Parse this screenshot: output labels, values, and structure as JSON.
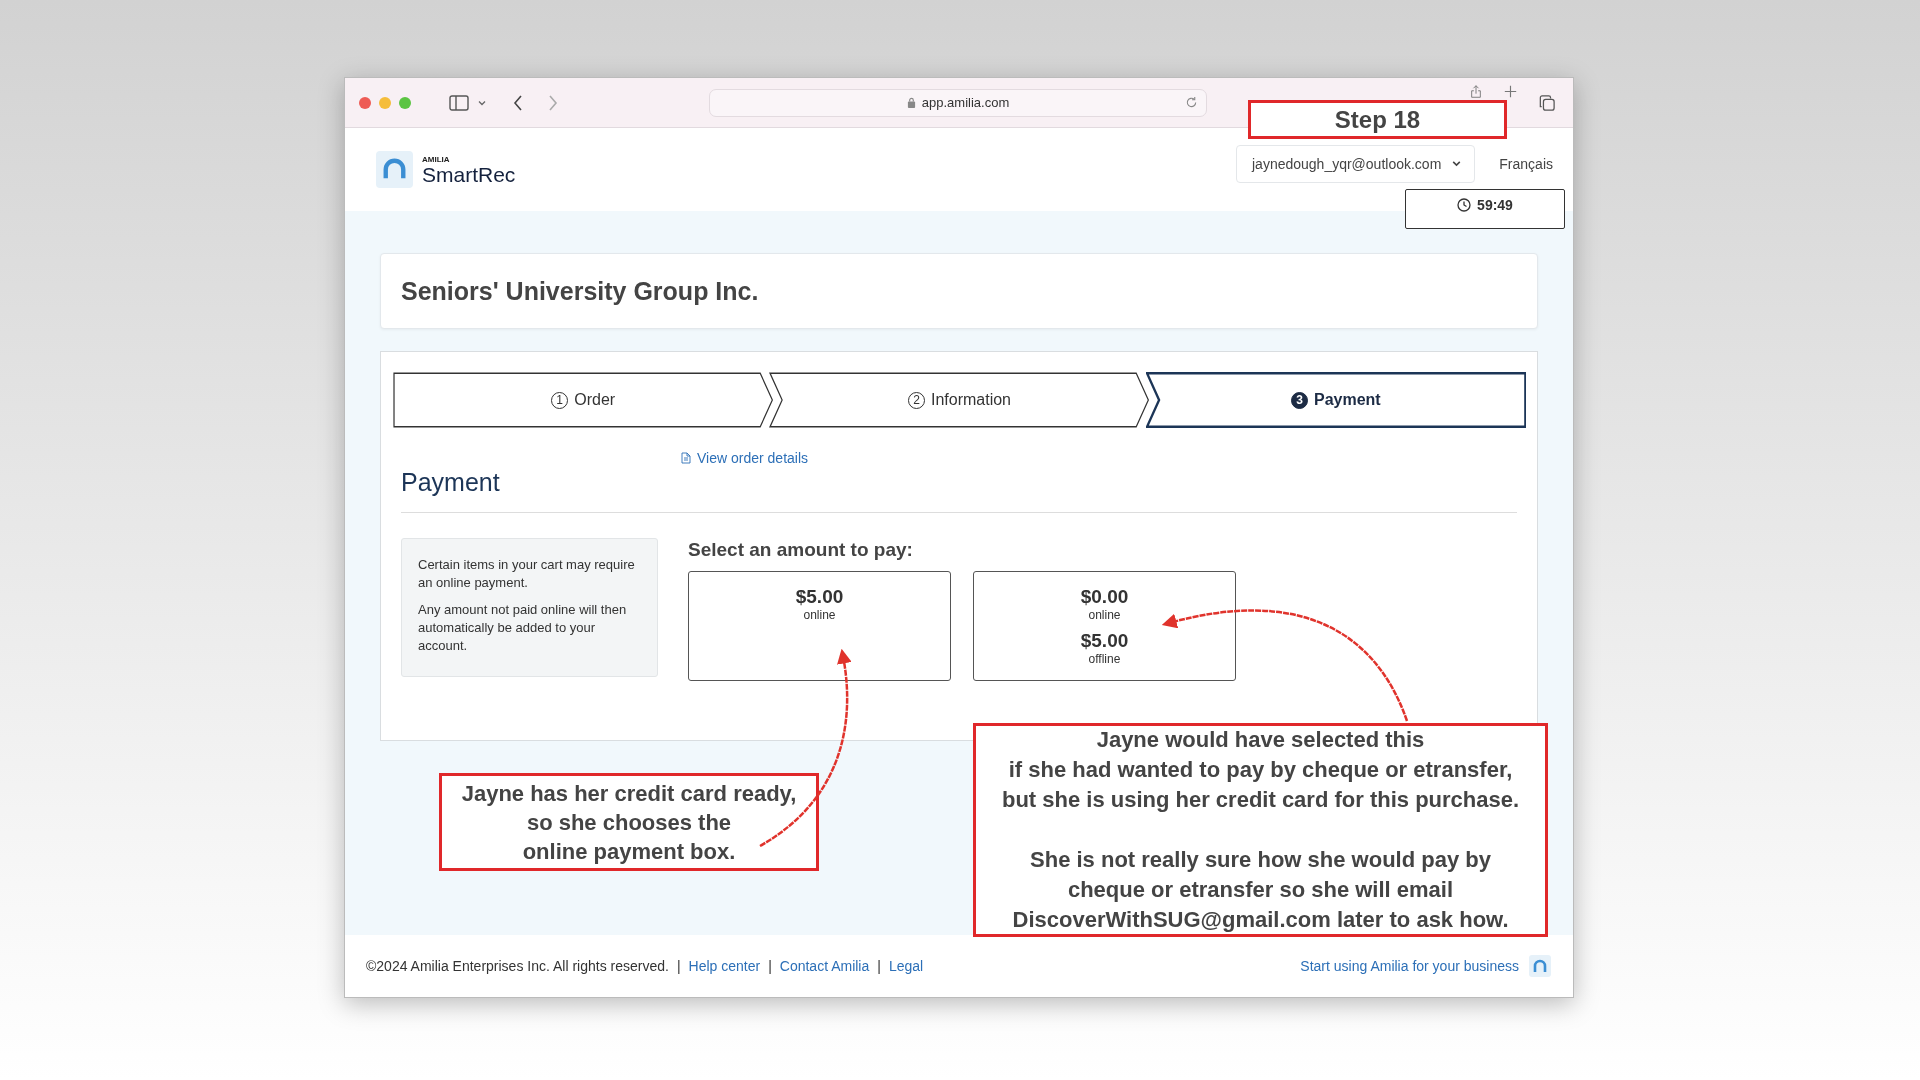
{
  "browser": {
    "url": "app.amilia.com"
  },
  "header": {
    "brand_small": "AMILIA",
    "brand": "SmartRec",
    "account": "jaynedough_yqr@outlook.com",
    "language": "Français",
    "timer": "59:49"
  },
  "organization": "Seniors' University Group Inc.",
  "steps": [
    {
      "number": "1",
      "label": "Order",
      "selected": false
    },
    {
      "number": "2",
      "label": "Information",
      "selected": false
    },
    {
      "number": "3",
      "label": "Payment",
      "selected": true
    }
  ],
  "payment": {
    "title": "Payment",
    "link": "View order details",
    "notes": [
      "Certain items in your cart may require an online payment.",
      "Any amount not paid online will then automatically be added to your account."
    ],
    "prompt": "Select an amount to pay:",
    "options": [
      {
        "lines": [
          {
            "amount": "$5.00",
            "label": "online"
          }
        ]
      },
      {
        "lines": [
          {
            "amount": "$0.00",
            "label": "online"
          },
          {
            "amount": "$5.00",
            "label": "offline"
          }
        ]
      }
    ]
  },
  "footer": {
    "copyright": "©2024 Amilia Enterprises Inc. All rights reserved.",
    "separator": "|",
    "links": [
      "Help center",
      "Contact Amilia",
      "Legal"
    ],
    "cta": "Start using Amilia for your business"
  },
  "annotations": [
    {
      "kind": "label",
      "paragraphs": [
        [
          "Step 18"
        ]
      ]
    },
    {
      "kind": "callout",
      "paragraphs": [
        [
          "Jayne has her credit card ready,",
          "so she chooses the",
          "online payment box."
        ]
      ]
    },
    {
      "kind": "callout",
      "paragraphs": [
        [
          "Jayne would have selected this",
          "if she had wanted to pay by cheque or etransfer,",
          "but she is using her credit card for this purchase."
        ],
        [
          "She is not really sure how she would pay by",
          "cheque or etransfer so she will email",
          "DiscoverWithSUG@gmail.com later to ask how."
        ]
      ]
    }
  ]
}
